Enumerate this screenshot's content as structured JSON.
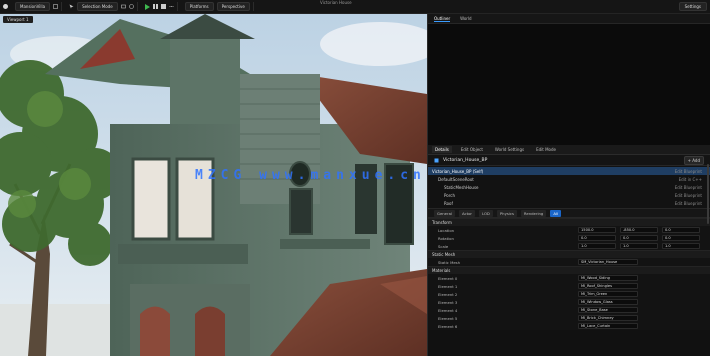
{
  "toolbar": {
    "level_tab": "MansionVilla",
    "mode_tab": "Selection Mode",
    "perspective_tab": "Perspective",
    "platform_tab": "Platforms",
    "window_title": "Victorian House",
    "settings_label": "Settings"
  },
  "viewport": {
    "label": "Viewport 1"
  },
  "right_top_tabs": [
    "Outliner",
    "World"
  ],
  "detail_tabs": [
    "Details",
    "Edit Object",
    "World Settings",
    "Edit Mode"
  ],
  "selection": {
    "name": "Victorian_House_BP",
    "button": "+ Add"
  },
  "component_tree": [
    {
      "label": "Victorian_House_BP (Self)",
      "right": "Edit Blueprint",
      "selected": true
    },
    {
      "label": "DefaultSceneRoot",
      "right": "Edit in C++",
      "selected": false
    },
    {
      "label": "StaticMeshHouse",
      "right": "Edit Blueprint",
      "selected": false
    },
    {
      "label": "Porch",
      "right": "Edit Blueprint",
      "selected": false
    },
    {
      "label": "Roof",
      "right": "Edit Blueprint",
      "selected": false
    }
  ],
  "filters": [
    "General",
    "Actor",
    "LOD",
    "Physics",
    "Rendering",
    "All"
  ],
  "sections": {
    "transform": "Transform",
    "static_mesh": "Static Mesh",
    "materials": "Materials"
  },
  "transform_rows": [
    {
      "label": "Location",
      "x": "1500.0",
      "y": "-850.0",
      "z": "0.0"
    },
    {
      "label": "Rotation",
      "x": "0.0",
      "y": "0.0",
      "z": "0.0"
    },
    {
      "label": "Scale",
      "x": "1.0",
      "y": "1.0",
      "z": "1.0"
    }
  ],
  "static_mesh": {
    "label": "Static Mesh",
    "value": "SM_Victorian_House"
  },
  "material_rows": [
    {
      "label": "Element 0",
      "value": "MI_Wood_Siding"
    },
    {
      "label": "Element 1",
      "value": "MI_Roof_Shingles"
    },
    {
      "label": "Element 2",
      "value": "MI_Trim_Green"
    },
    {
      "label": "Element 3",
      "value": "MI_Window_Glass"
    },
    {
      "label": "Element 4",
      "value": "MI_Stone_Base"
    },
    {
      "label": "Element 5",
      "value": "MI_Brick_Chimney"
    },
    {
      "label": "Element 6",
      "value": "MI_Lace_Curtain"
    }
  ],
  "watermark": "MZCG www.manxue.cn",
  "colors": {
    "accent": "#1a66c9",
    "watermark": "#2f73ff",
    "selection": "#1f3e63"
  }
}
